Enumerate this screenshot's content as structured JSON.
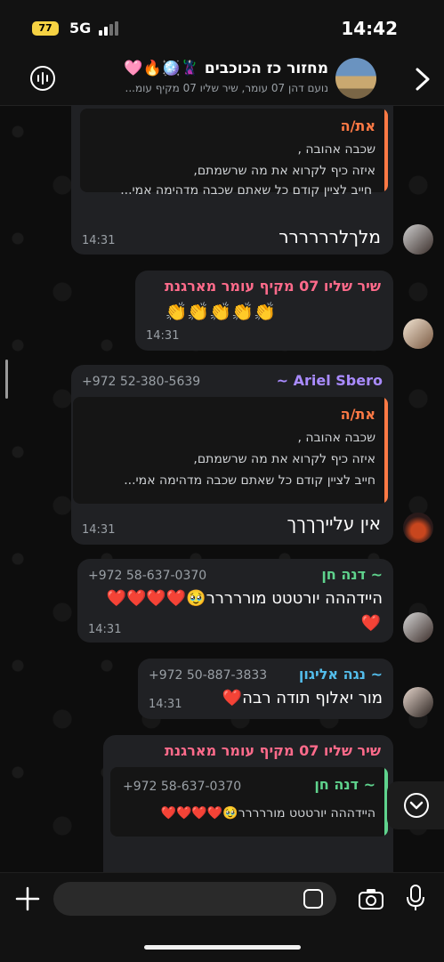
{
  "status_bar": {
    "time": "14:42",
    "battery": "77",
    "network": "5G"
  },
  "header": {
    "title": "מחזור כז הכוכבים 🦹‍♀️🪩🔥🩷",
    "subtitle": "נועם דהן 07 עומר, שיר שליו 07 מקיף עומ...",
    "icons": [
      "back-chevron-icon",
      "group-avatar",
      "voice-chat-icon"
    ]
  },
  "messages": [
    {
      "quote": {
        "name": "את/ה",
        "lines": [
          "שכבה אהובה ,",
          "איזה כיף לקרוא את מה שרשמתם,",
          "חייב לציין קודם כל שאתם שכבה מדהימה אמי..."
        ]
      },
      "text": "מלךלרררררר",
      "time": "14:31"
    },
    {
      "sender": "שיר שליו 07 מקיף עומר מארגנת",
      "text": "👏👏👏👏👏",
      "time": "14:31"
    },
    {
      "sender": "~ Ariel Sbero",
      "phone": "+972 52-380-5639",
      "quote": {
        "name": "את/ה",
        "lines": [
          "שכבה אהובה ,",
          "איזה כיף לקרוא את מה שרשמתם,",
          "חייב לציין קודם כל שאתם שכבה מדהימה אמי..."
        ]
      },
      "text": "אין עלייךךךך",
      "time": "14:31"
    },
    {
      "sender": "~ דנה חן",
      "phone": "+972 58-637-0370",
      "text": "היידההה יורטטט מוררררר🥹❤️❤️❤️❤️",
      "text2": "❤️",
      "time": "14:31"
    },
    {
      "sender": "~ נגה אליגון",
      "phone": "+972 50-887-3833",
      "text": "מור יאלוף תודה רבה❤️",
      "time": "14:31"
    },
    {
      "sender": "שיר שליו 07 מקיף עומר מארגנת",
      "quote": {
        "name": "~ דנה חן",
        "phone": "+972 58-637-0370",
        "lines": [
          "היידההה יורטטט מוררררר🥹❤️❤️❤️❤️"
        ]
      }
    }
  ],
  "colors": {
    "quote_name": "#ff7a45",
    "sender_pink": "#ff6b8b",
    "sender_purple": "#a98bff",
    "sender_green": "#5fd38d",
    "sender_teal": "#53bdeb",
    "accent_green": "#25d366"
  },
  "input": {
    "placeholder": ""
  }
}
